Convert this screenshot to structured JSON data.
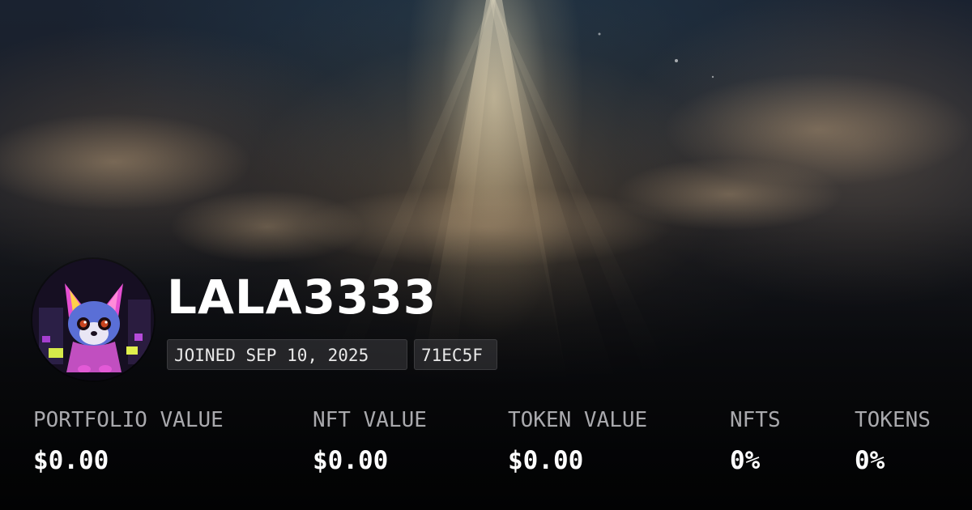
{
  "profile": {
    "username": "LALA3333",
    "joined": "JOINED SEP 10, 2025",
    "id_badge": "71EC5F"
  },
  "stats": [
    {
      "label": "PORTFOLIO VALUE",
      "value": "$0.00"
    },
    {
      "label": "NFT VALUE",
      "value": "$0.00"
    },
    {
      "label": "TOKEN VALUE",
      "value": "$0.00"
    },
    {
      "label": "NFTS",
      "value": "0%"
    },
    {
      "label": "TOKENS",
      "value": "0%"
    }
  ]
}
